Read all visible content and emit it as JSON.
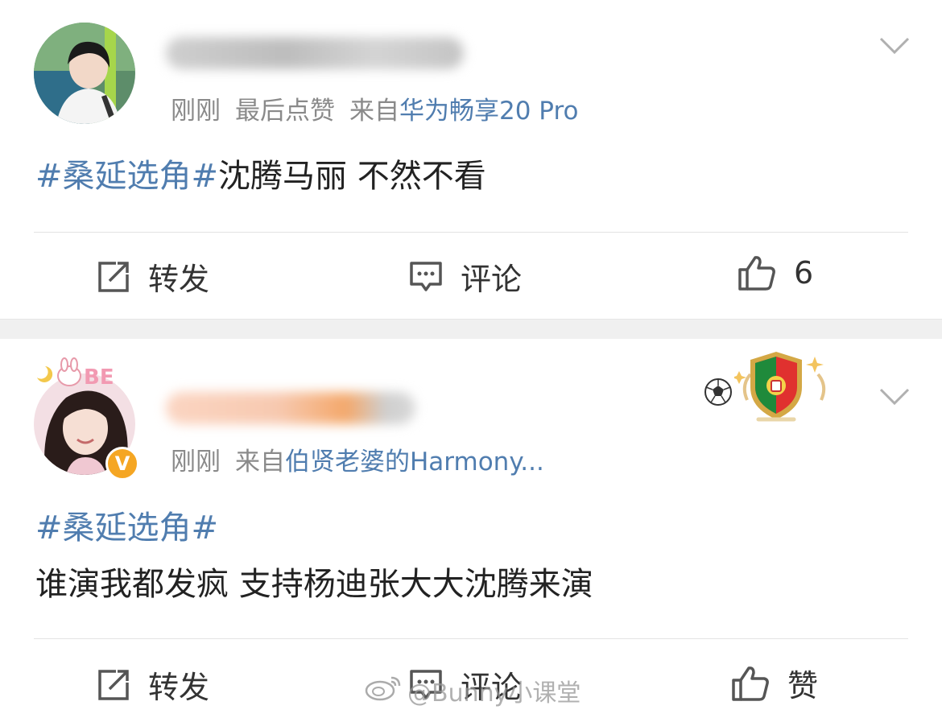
{
  "posts": [
    {
      "meta": {
        "time": "刚刚",
        "liked": "最后点赞",
        "from": "来自",
        "source": "华为畅享20 Pro"
      },
      "content": {
        "tag": "#桑延选角#",
        "text": "沈腾马丽 不然不看"
      },
      "actions": {
        "repost": "转发",
        "comment": "评论",
        "like": "6"
      }
    },
    {
      "meta": {
        "time": "刚刚",
        "from": "来自",
        "source": "伯贤老婆的Harmony..."
      },
      "content": {
        "tag": "#桑延选角#",
        "text": "谁演我都发疯 支持杨迪张大大沈腾来演"
      },
      "actions": {
        "repost": "转发",
        "comment": "评论",
        "like": "赞"
      },
      "verified": "V"
    }
  ],
  "watermark": "@Bunny小课堂",
  "colors": {
    "link": "#507daf",
    "meta": "#8a8a8a",
    "text": "#222222",
    "verified": "#f5a623"
  },
  "icons": [
    "repost-icon",
    "comment-icon",
    "thumbs-up-icon",
    "chevron-down-icon",
    "verified-badge-icon",
    "football-icon",
    "portugal-shield-icon",
    "weibo-logo-icon"
  ]
}
